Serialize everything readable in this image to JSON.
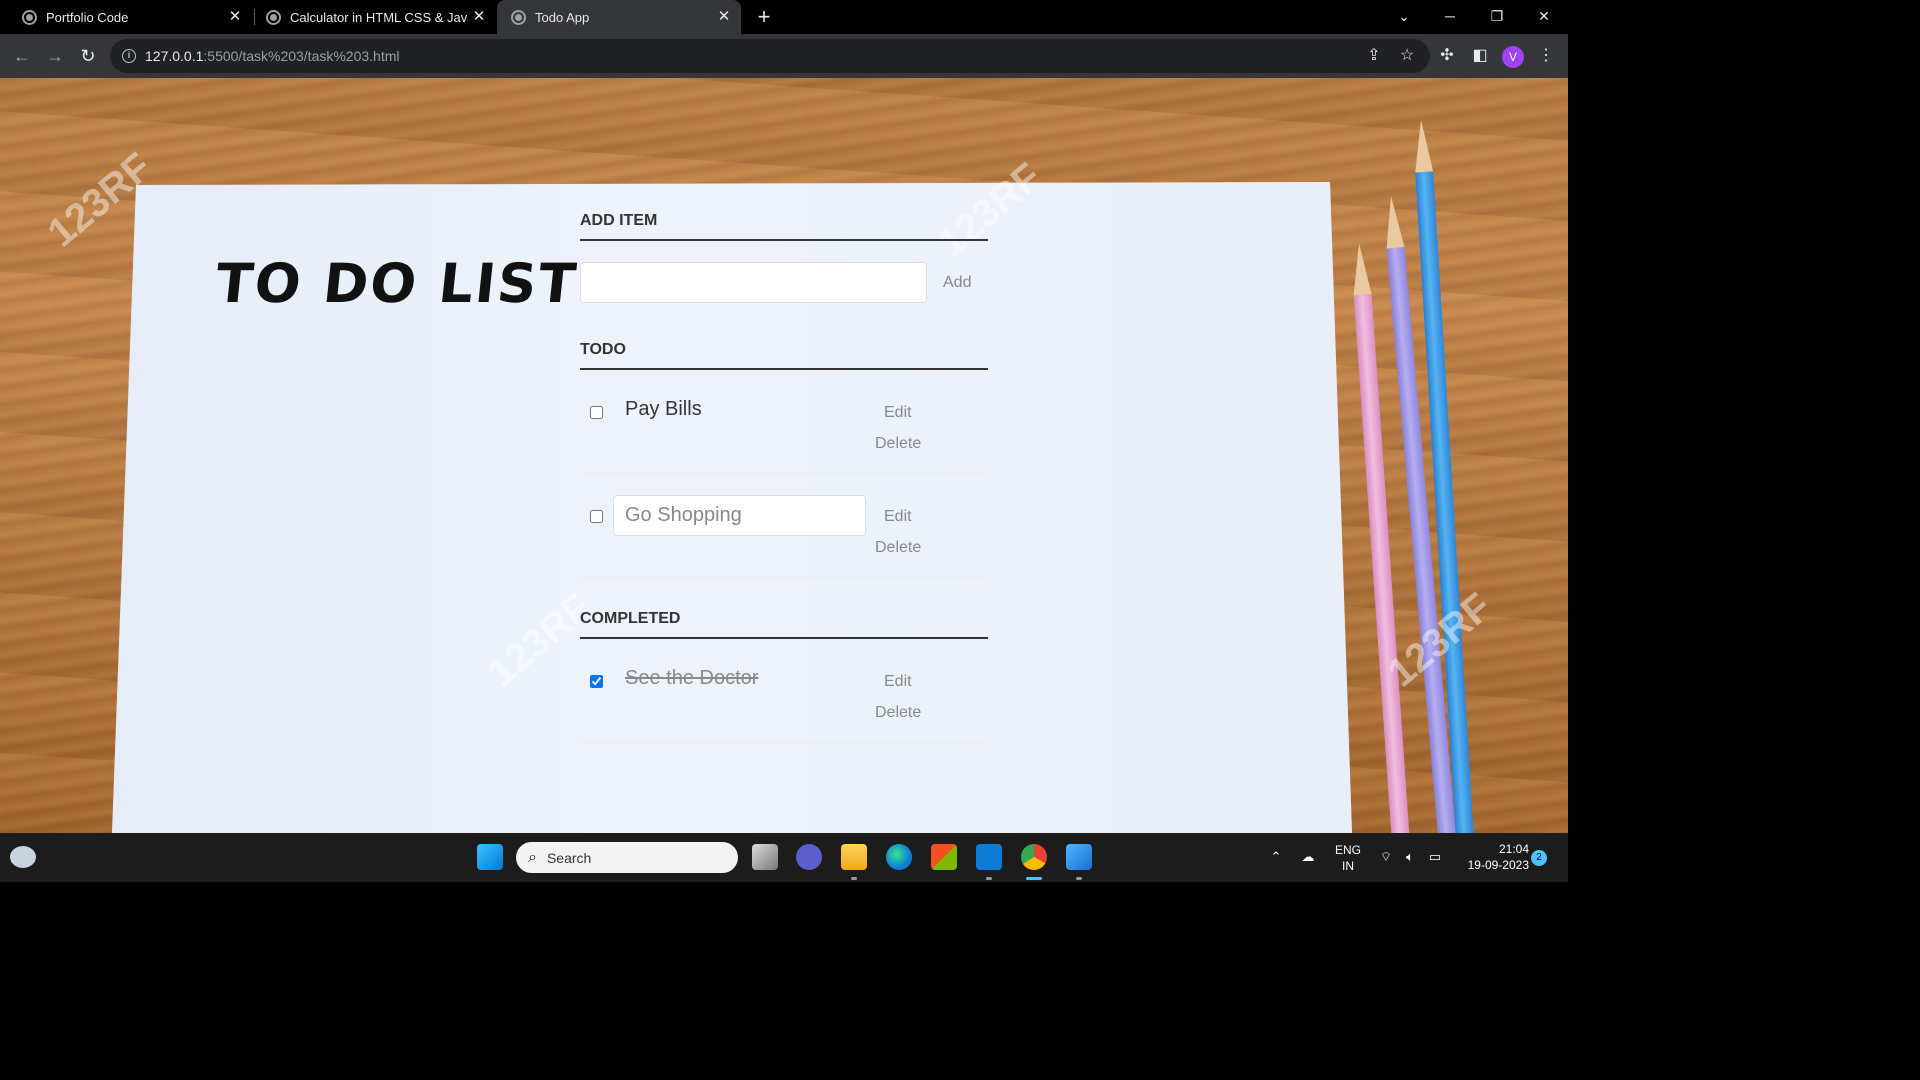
{
  "browser": {
    "tabs": [
      {
        "title": "Portfolio Code",
        "active": false
      },
      {
        "title": "Calculator in HTML CSS & JavaScript",
        "active": false
      },
      {
        "title": "Todo App",
        "active": true
      }
    ],
    "url_host": "127.0.0.1",
    "url_path": ":5500/task%203/task%203.html",
    "profile_initial": "V",
    "new_tab_glyph": "+",
    "close_glyph": "✕"
  },
  "app": {
    "title": "TO DO LIST",
    "add_section": {
      "heading": "ADD ITEM",
      "input_value": "",
      "add_label": "Add"
    },
    "todo_section": {
      "heading": "TODO",
      "items": [
        {
          "text": "Pay Bills",
          "checked": false,
          "editing": false,
          "edit_label": "Edit",
          "delete_label": "Delete"
        },
        {
          "text": "Go Shopping",
          "checked": false,
          "editing": true,
          "edit_label": "Edit",
          "delete_label": "Delete"
        }
      ]
    },
    "completed_section": {
      "heading": "COMPLETED",
      "items": [
        {
          "text": "See the Doctor",
          "checked": true,
          "editing": false,
          "edit_label": "Edit",
          "delete_label": "Delete"
        }
      ]
    },
    "watermark": "123RF"
  },
  "taskbar": {
    "search_placeholder": "Search",
    "language_top": "ENG",
    "language_bottom": "IN",
    "time": "21:04",
    "date": "19-09-2023",
    "notification_count": "2",
    "accent_color": "#4cc2ff"
  }
}
